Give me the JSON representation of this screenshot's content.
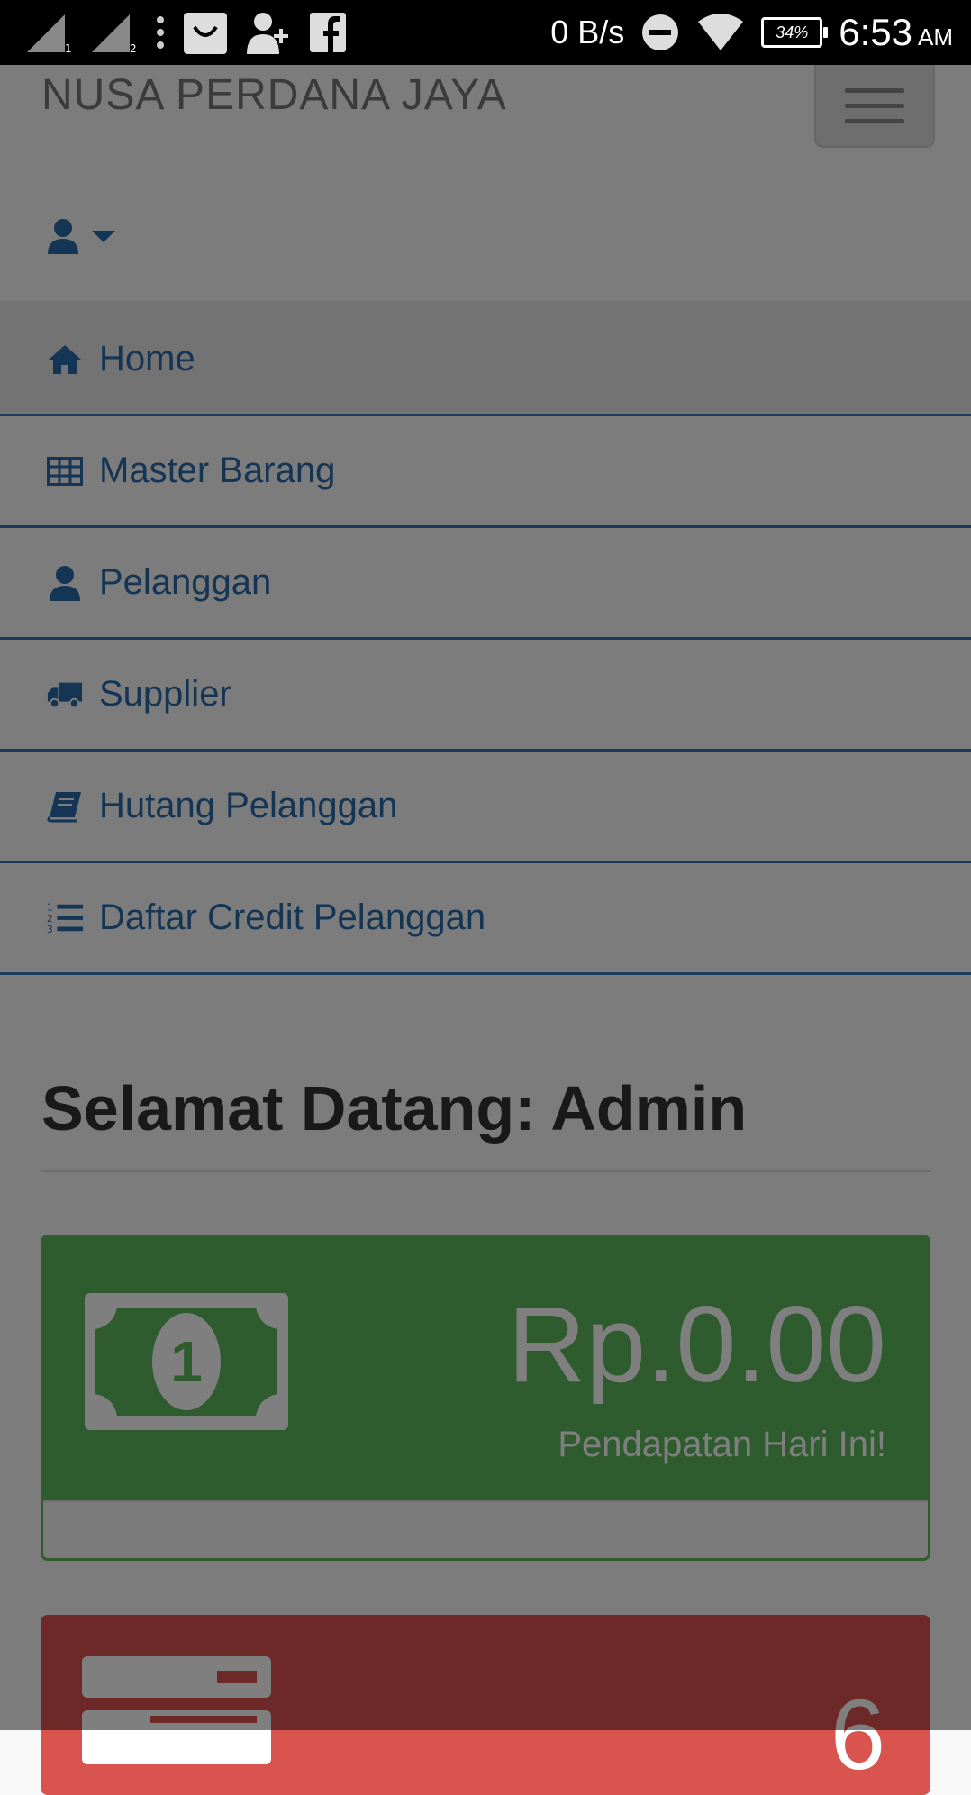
{
  "status_bar": {
    "speed": "0 B/s",
    "battery": "34%",
    "time": "6:53",
    "ampm": "AM"
  },
  "navbar": {
    "brand": "NUSA PERDANA JAYA"
  },
  "menu": {
    "items": [
      {
        "label": "Home",
        "icon": "home-icon"
      },
      {
        "label": "Master Barang",
        "icon": "table-icon"
      },
      {
        "label": "Pelanggan",
        "icon": "user-icon"
      },
      {
        "label": "Supplier",
        "icon": "truck-icon"
      },
      {
        "label": "Hutang Pelanggan",
        "icon": "book-icon"
      },
      {
        "label": "Daftar Credit Pelanggan",
        "icon": "ordered-list-icon"
      }
    ]
  },
  "main": {
    "welcome_prefix": "Selamat Datang: ",
    "welcome_user": "Admin",
    "income_value": "Rp.0.00",
    "income_label": "Pendapatan Hari Ini!",
    "second_value": "6"
  },
  "colors": {
    "link": "#337ab7",
    "success": "#5cb85c",
    "danger": "#d9534f"
  }
}
